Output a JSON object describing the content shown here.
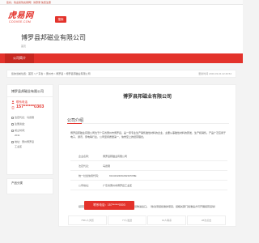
{
  "topbar": {
    "text": "您好，欢迎来到虎易网！请登录 免费注册"
  },
  "logo": {
    "main": "虎易网",
    "sub": "COOVEE.COM"
  },
  "search_button": "搜索",
  "company": {
    "title": "博罗县邦磁业有限公司",
    "subtitle": "首页"
  },
  "nav": {
    "items": [
      "公司简介"
    ]
  },
  "breadcrumb": {
    "path": "您的当前位置：首页 > 广东省 > 惠州市 > 博罗县 > 博罗县邦磁业有限公司",
    "pubtime": "更新时间 2020-03-04 22:46:54"
  },
  "sidebar": {
    "company_name": "博罗县邦磁业有限公司",
    "contact_label": "联系电话",
    "phone": "157******0303",
    "info": [
      "法定代表：马德刚",
      "注册资金：",
      "成立时间：",
      "2011",
      "地址：惠州博罗县",
      "工业区"
    ],
    "info_icons": [
      "user-icon",
      "money-icon",
      "calendar-icon",
      "",
      "location-icon",
      ""
    ]
  },
  "products": {
    "title": "产品分类"
  },
  "main": {
    "title": "博罗县邦磁业有限公司",
    "section_title": "公司介绍",
    "description": "博罗县邦磁业有限公司位于广东省惠州市博罗县，是一家专业生产销售磁性材料的企业，主要从事磁性材料的研发、生产和销售。产品广泛应用于电子、通讯、家电等行业，公司坚持质量第一、信誉至上的经营理念。",
    "details": [
      {
        "key": "企业名称：",
        "value": "博罗县邦磁业有限公司"
      },
      {
        "key": "法定代表：",
        "value": "马德刚"
      },
      {
        "key": "统一社会信用代码：",
        "value": "91441322MA4W4U5X8E"
      },
      {
        "key": "公司地址：",
        "value": "广东省惠州市博罗县工业区"
      }
    ],
    "scope": "经营范围：加工、销售：磁性材料制品、电子元件；货物进出口。（依法须经批准的项目，经相关部门批准后方可开展经营活动）"
  },
  "cta": {
    "label": "联系电话：157******0303"
  },
  "stats": [
    "7561人浏览",
    "77人发送",
    "19人联系",
    "28次点击"
  ]
}
